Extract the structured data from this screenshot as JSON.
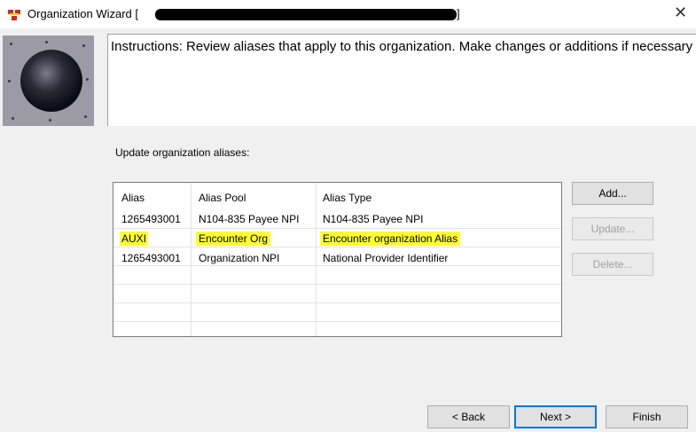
{
  "window": {
    "title": "Organization Wizard [",
    "title_suffix": "]",
    "close_symbol": "✕"
  },
  "instructions": "Instructions: Review aliases that apply to this organization. Make changes or additions if necessary",
  "aliases_label": "Update organization aliases:",
  "table": {
    "headers": [
      "Alias",
      "Alias Pool",
      "Alias Type"
    ],
    "rows": [
      {
        "alias": "1265493001",
        "pool": "N104-835 Payee NPI",
        "type": "N104-835 Payee NPI",
        "highlighted": false
      },
      {
        "alias": "AUXI",
        "pool": "Encounter Org",
        "type": "Encounter organization Alias",
        "highlighted": true
      },
      {
        "alias": "1265493001",
        "pool": "Organization NPI",
        "type": "National Provider Identifier",
        "highlighted": false
      }
    ]
  },
  "side_buttons": {
    "add": "Add...",
    "update": "Update...",
    "delete": "Delete..."
  },
  "nav_buttons": {
    "back": "< Back",
    "next": "Next >",
    "finish": "Finish"
  },
  "colors": {
    "highlight": "#ffff33",
    "default_button_border": "#0078d7",
    "dialog_background": "#f0f0f0"
  }
}
